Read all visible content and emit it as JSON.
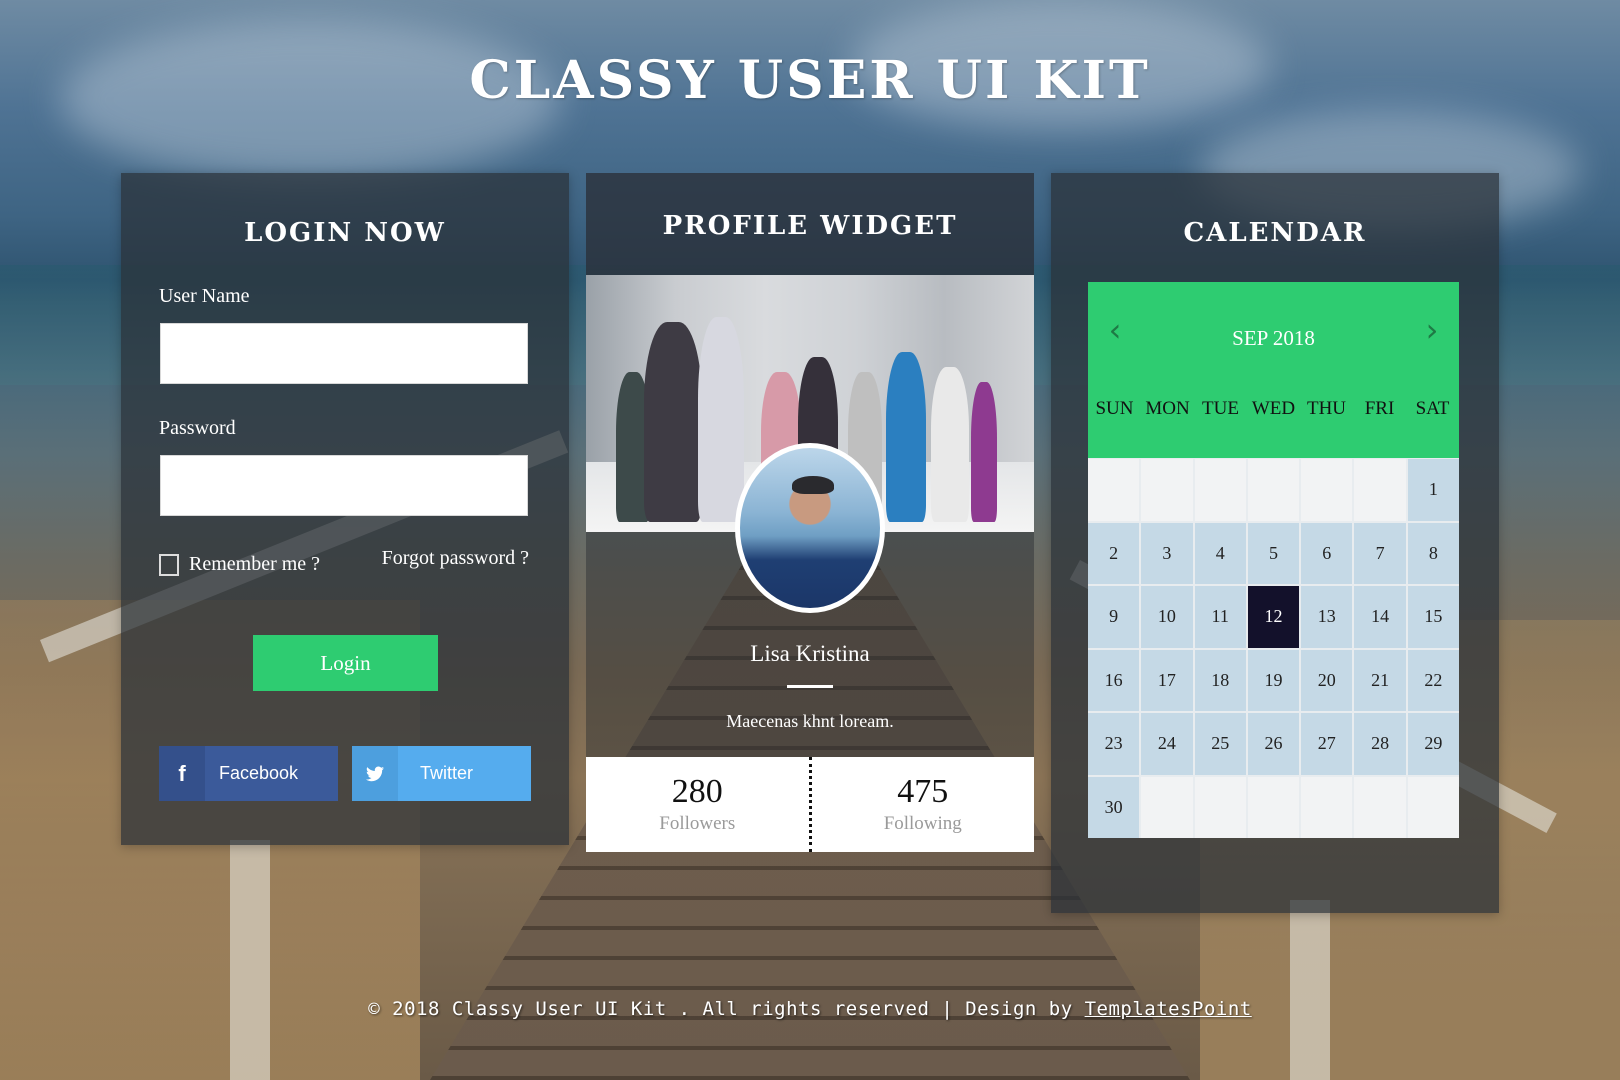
{
  "page": {
    "title": "CLASSY USER UI KIT"
  },
  "login": {
    "title": "LOGIN NOW",
    "username_label": "User Name",
    "username_value": "",
    "password_label": "Password",
    "password_value": "",
    "remember_label": "Remember me ?",
    "remember_checked": false,
    "forgot_label": "Forgot password ?",
    "login_button": "Login",
    "social": [
      {
        "name": "facebook",
        "icon": "f",
        "label": "Facebook",
        "color": "#3b5a9a"
      },
      {
        "name": "twitter",
        "icon": "🐦",
        "label": "Twitter",
        "color": "#55acee"
      }
    ]
  },
  "profile": {
    "title": "PROFILE WIDGET",
    "name": "Lisa Kristina",
    "bio": "Maecenas khnt loream.",
    "stats": [
      {
        "value": "280",
        "label": "Followers"
      },
      {
        "value": "475",
        "label": "Following"
      }
    ]
  },
  "calendar": {
    "title": "CALENDAR",
    "month_label": "SEP 2018",
    "prev_icon": "‹",
    "next_icon": "›",
    "weekdays": [
      "SUN",
      "MON",
      "TUE",
      "WED",
      "THU",
      "FRI",
      "SAT"
    ],
    "days": [
      "",
      "",
      "",
      "",
      "",
      "",
      "1",
      "2",
      "3",
      "4",
      "5",
      "6",
      "7",
      "8",
      "9",
      "10",
      "11",
      "12",
      "13",
      "14",
      "15",
      "16",
      "17",
      "18",
      "19",
      "20",
      "21",
      "22",
      "23",
      "24",
      "25",
      "26",
      "27",
      "28",
      "29",
      "30",
      "",
      "",
      "",
      "",
      "",
      ""
    ],
    "selected_day": "12",
    "accent_color": "#2ecc71",
    "selected_color": "#13112b"
  },
  "footer": {
    "text": "© 2018 Classy User UI Kit . All rights reserved | Design by ",
    "link": "TemplatesPoint"
  }
}
